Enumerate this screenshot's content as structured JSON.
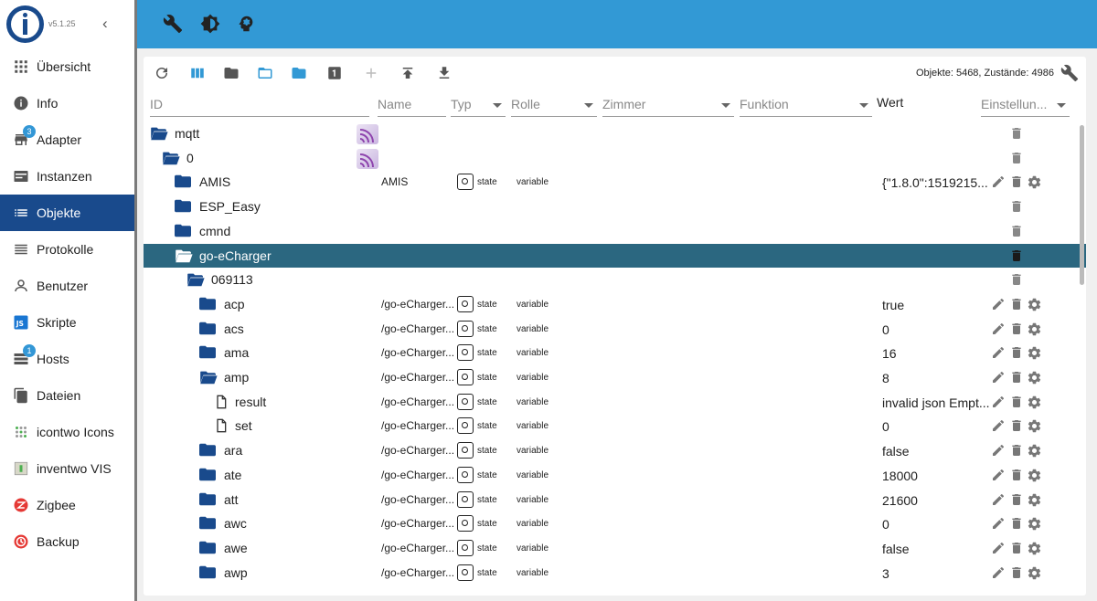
{
  "app": {
    "version": "v5.1.25"
  },
  "sidebar": {
    "items": [
      {
        "label": "Übersicht",
        "icon": "grid-icon"
      },
      {
        "label": "Info",
        "icon": "info-icon"
      },
      {
        "label": "Adapter",
        "icon": "store-icon",
        "badge": "3"
      },
      {
        "label": "Instanzen",
        "icon": "instances-icon"
      },
      {
        "label": "Objekte",
        "icon": "list-icon",
        "active": true
      },
      {
        "label": "Protokolle",
        "icon": "log-icon"
      },
      {
        "label": "Benutzer",
        "icon": "user-icon"
      },
      {
        "label": "Skripte",
        "icon": "js-icon"
      },
      {
        "label": "Hosts",
        "icon": "server-icon",
        "badge": "1"
      },
      {
        "label": "Dateien",
        "icon": "files-icon"
      },
      {
        "label": "icontwo Icons",
        "icon": "icontwo-icon"
      },
      {
        "label": "inventwo VIS",
        "icon": "inventwo-icon"
      },
      {
        "label": "Zigbee",
        "icon": "zigbee-icon"
      },
      {
        "label": "Backup",
        "icon": "backup-icon"
      }
    ]
  },
  "toolbar": {
    "counts": "Objekte: 5468, Zustände: 4986"
  },
  "columns": {
    "id": "ID",
    "name": "Name",
    "type": "Typ",
    "role": "Rolle",
    "room": "Zimmer",
    "function": "Funktion",
    "value": "Wert",
    "settings": "Einstellun..."
  },
  "rows": [
    {
      "name": "mqtt",
      "depth": 0,
      "icon": "folder-open",
      "thumb": true,
      "trash": true
    },
    {
      "name": "0",
      "depth": 1,
      "icon": "folder-open",
      "thumb": true,
      "trash": true
    },
    {
      "name": "AMIS",
      "depth": 2,
      "icon": "folder",
      "oname": "AMIS",
      "type": "state",
      "role": "variable",
      "value": "{\"1.8.0\":1519215...",
      "actions": true
    },
    {
      "name": "ESP_Easy",
      "depth": 2,
      "icon": "folder",
      "trash": true
    },
    {
      "name": "cmnd",
      "depth": 2,
      "icon": "folder",
      "trash": true
    },
    {
      "name": "go-eCharger",
      "depth": 2,
      "icon": "folder-open",
      "selected": true,
      "trash": true
    },
    {
      "name": "069113",
      "depth": 3,
      "icon": "folder-open",
      "trash": true
    },
    {
      "name": "acp",
      "depth": 4,
      "icon": "folder",
      "oname": "/go-eCharger...",
      "type": "state",
      "role": "variable",
      "value": "true",
      "actions": true
    },
    {
      "name": "acs",
      "depth": 4,
      "icon": "folder",
      "oname": "/go-eCharger...",
      "type": "state",
      "role": "variable",
      "value": "0",
      "actions": true
    },
    {
      "name": "ama",
      "depth": 4,
      "icon": "folder",
      "oname": "/go-eCharger...",
      "type": "state",
      "role": "variable",
      "value": "16",
      "actions": true
    },
    {
      "name": "amp",
      "depth": 4,
      "icon": "folder-open",
      "oname": "/go-eCharger...",
      "type": "state",
      "role": "variable",
      "value": "8",
      "actions": true
    },
    {
      "name": "result",
      "depth": 5,
      "icon": "file",
      "oname": "/go-eCharger...",
      "type": "state",
      "role": "variable",
      "value": "invalid json Empt...",
      "actions": true
    },
    {
      "name": "set",
      "depth": 5,
      "icon": "file",
      "oname": "/go-eCharger...",
      "type": "state",
      "role": "variable",
      "value": "0",
      "actions": true
    },
    {
      "name": "ara",
      "depth": 4,
      "icon": "folder",
      "oname": "/go-eCharger...",
      "type": "state",
      "role": "variable",
      "value": "false",
      "actions": true
    },
    {
      "name": "ate",
      "depth": 4,
      "icon": "folder",
      "oname": "/go-eCharger...",
      "type": "state",
      "role": "variable",
      "value": "18000",
      "actions": true
    },
    {
      "name": "att",
      "depth": 4,
      "icon": "folder",
      "oname": "/go-eCharger...",
      "type": "state",
      "role": "variable",
      "value": "21600",
      "actions": true
    },
    {
      "name": "awc",
      "depth": 4,
      "icon": "folder",
      "oname": "/go-eCharger...",
      "type": "state",
      "role": "variable",
      "value": "0",
      "actions": true
    },
    {
      "name": "awe",
      "depth": 4,
      "icon": "folder",
      "oname": "/go-eCharger...",
      "type": "state",
      "role": "variable",
      "value": "false",
      "actions": true
    },
    {
      "name": "awp",
      "depth": 4,
      "icon": "folder",
      "oname": "/go-eCharger...",
      "type": "state",
      "role": "variable",
      "value": "3",
      "actions": true
    }
  ],
  "colors": {
    "topbar": "#3299d5",
    "active": "#194a8c",
    "selected_row": "#2b6780",
    "folder": "#194a8c"
  }
}
